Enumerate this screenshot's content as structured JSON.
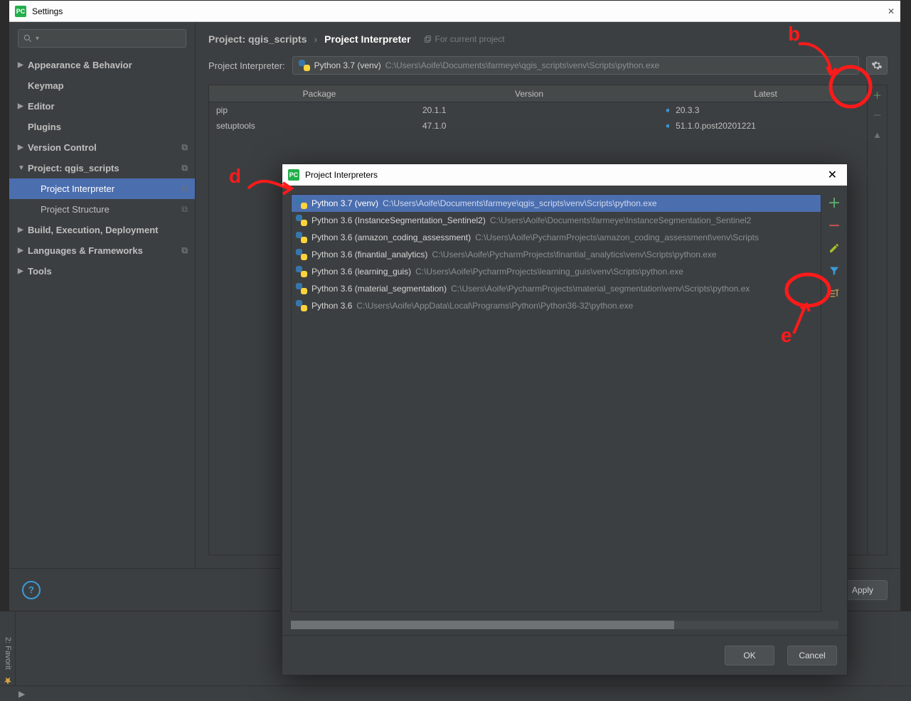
{
  "window": {
    "title": "Settings"
  },
  "sidebar": {
    "search_placeholder": "",
    "items": [
      {
        "label": "Appearance & Behavior",
        "expandable": true
      },
      {
        "label": "Keymap"
      },
      {
        "label": "Editor",
        "expandable": true
      },
      {
        "label": "Plugins"
      },
      {
        "label": "Version Control",
        "expandable": true,
        "copy": true
      },
      {
        "label": "Project: qgis_scripts",
        "expandable": true,
        "expanded": true,
        "copy": true,
        "children": [
          {
            "label": "Project Interpreter",
            "active": true,
            "copy": true
          },
          {
            "label": "Project Structure",
            "copy": true
          }
        ]
      },
      {
        "label": "Build, Execution, Deployment",
        "expandable": true
      },
      {
        "label": "Languages & Frameworks",
        "expandable": true,
        "copy": true
      },
      {
        "label": "Tools",
        "expandable": true
      }
    ]
  },
  "breadcrumb": {
    "a": "Project: qgis_scripts",
    "b": "Project Interpreter",
    "scope": "For current project"
  },
  "interpreter_row": {
    "label": "Project Interpreter:",
    "selected_name": "Python 3.7 (venv)",
    "selected_path": "C:\\Users\\Aoife\\Documents\\farmeye\\qgis_scripts\\venv\\Scripts\\python.exe"
  },
  "packages": {
    "columns": {
      "package": "Package",
      "version": "Version",
      "latest": "Latest"
    },
    "rows": [
      {
        "name": "pip",
        "version": "20.1.1",
        "latest": "20.3.3"
      },
      {
        "name": "setuptools",
        "version": "47.1.0",
        "latest": "51.1.0.post20201221"
      }
    ]
  },
  "footer_buttons": {
    "help_tooltip": "Help",
    "apply": "Apply"
  },
  "pi_dialog": {
    "title": "Project Interpreters",
    "items": [
      {
        "name": "Python 3.7 (venv)",
        "path": "C:\\Users\\Aoife\\Documents\\farmeye\\qgis_scripts\\venv\\Scripts\\python.exe",
        "selected": true
      },
      {
        "name": "Python 3.6 (InstanceSegmentation_Sentinel2)",
        "path": "C:\\Users\\Aoife\\Documents\\farmeye\\InstanceSegmentation_Sentinel2"
      },
      {
        "name": "Python 3.6 (amazon_coding_assessment)",
        "path": "C:\\Users\\Aoife\\PycharmProjects\\amazon_coding_assessment\\venv\\Scripts"
      },
      {
        "name": "Python 3.6 (finantial_analytics)",
        "path": "C:\\Users\\Aoife\\PycharmProjects\\finantial_analytics\\venv\\Scripts\\python.exe"
      },
      {
        "name": "Python 3.6 (learning_guis)",
        "path": "C:\\Users\\Aoife\\PycharmProjects\\learning_guis\\venv\\Scripts\\python.exe"
      },
      {
        "name": "Python 3.6 (material_segmentation)",
        "path": "C:\\Users\\Aoife\\PycharmProjects\\material_segmentation\\venv\\Scripts\\python.ex"
      },
      {
        "name": "Python 3.6",
        "path": "C:\\Users\\Aoife\\AppData\\Local\\Programs\\Python\\Python36-32\\python.exe"
      }
    ],
    "buttons": {
      "ok": "OK",
      "cancel": "Cancel"
    }
  },
  "annotations": {
    "b": "b",
    "d": "d",
    "e": "e"
  },
  "ide_strip": {
    "favorites": "2: Favorit"
  }
}
